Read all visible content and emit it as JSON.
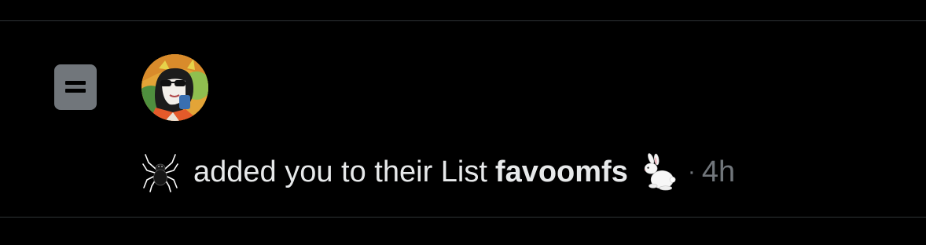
{
  "notification": {
    "actor_emoji_icon": "spider-icon",
    "message": "added you to their List",
    "list_name": "favoomfs",
    "list_emoji_icon": "rabbit-icon",
    "separator": "·",
    "time": "4h",
    "notification_icon": "list-icon",
    "avatar": "user-avatar"
  },
  "colors": {
    "background": "#000000",
    "divider": "#2f3336",
    "primary_text": "#e7e9ea",
    "secondary_text": "#71767b",
    "list_icon_bg": "#71767b"
  }
}
